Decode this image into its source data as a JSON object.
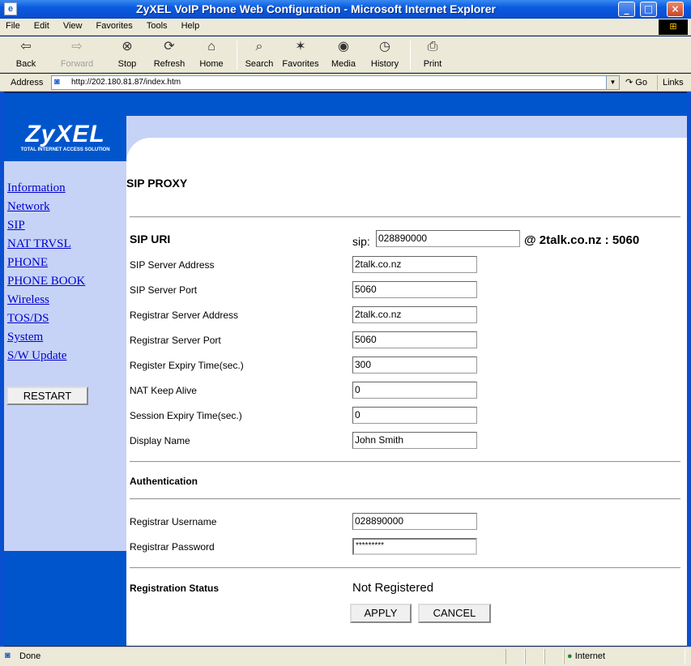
{
  "window": {
    "title": "ZyXEL VoIP Phone Web Configuration - Microsoft Internet Explorer",
    "minimize": "_",
    "maximize": "□",
    "close": "×"
  },
  "menu": [
    "File",
    "Edit",
    "View",
    "Favorites",
    "Tools",
    "Help"
  ],
  "toolbar": {
    "back": "Back",
    "forward": "Forward",
    "stop": "Stop",
    "refresh": "Refresh",
    "home": "Home",
    "search": "Search",
    "favorites": "Favorites",
    "media": "Media",
    "history": "History",
    "print": "Print"
  },
  "address": {
    "label": "Address",
    "url": "http://202.180.81.87/index.htm",
    "go": "Go",
    "links": "Links"
  },
  "logo": {
    "brand": "ZyXEL",
    "tagline": "TOTAL INTERNET ACCESS SOLUTION"
  },
  "nav": [
    "Information",
    "Network",
    "SIP",
    "NAT TRVSL",
    "PHONE",
    "PHONE BOOK",
    "Wireless",
    "TOS/DS",
    "System",
    "S/W Update"
  ],
  "restart_label": "RESTART",
  "page_title": "SIP PROXY",
  "sip_uri": {
    "label": "SIP URI",
    "prefix": "sip:",
    "value": "028890000",
    "suffix": "@ 2talk.co.nz : 5060"
  },
  "fields": [
    {
      "label": "SIP Server Address",
      "value": "2talk.co.nz"
    },
    {
      "label": "SIP Server Port",
      "value": "5060"
    },
    {
      "label": "Registrar Server Address",
      "value": "2talk.co.nz"
    },
    {
      "label": "Registrar Server Port",
      "value": "5060"
    },
    {
      "label": "Register Expiry Time(sec.)",
      "value": "300"
    },
    {
      "label": "NAT Keep Alive",
      "value": "0"
    },
    {
      "label": "Session Expiry Time(sec.)",
      "value": "0"
    },
    {
      "label": "Display Name",
      "value": "John Smith"
    }
  ],
  "auth": {
    "heading": "Authentication",
    "username_label": "Registrar Username",
    "username_value": "028890000",
    "password_label": "Registrar Password",
    "password_value": "*********"
  },
  "registration": {
    "label": "Registration Status",
    "value": "Not Registered"
  },
  "buttons": {
    "apply": "APPLY",
    "cancel": "CANCEL"
  },
  "status": {
    "text": "Done",
    "zone": "Internet"
  }
}
